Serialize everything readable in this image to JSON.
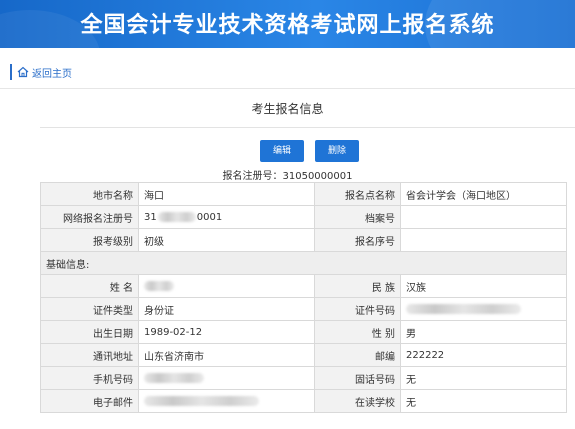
{
  "header": {
    "title": "全国会计专业技术资格考试网上报名系统"
  },
  "nav": {
    "back_label": "返回主页"
  },
  "page": {
    "title": "考生报名信息"
  },
  "actions": {
    "edit_label": "编辑",
    "delete_label": "删除"
  },
  "registration": {
    "line": "报名注册号：31050000001"
  },
  "table": {
    "rows": {
      "city_label": "地市名称",
      "city_value": "海口",
      "site_label": "报名点名称",
      "site_value": "省会计学会（海口地区）",
      "online_no_label": "网络报名注册号",
      "online_no_prefix": "31",
      "online_no_suffix": "0001",
      "archive_label": "档案号",
      "archive_value": "",
      "level_label": "报考级别",
      "level_value": "初级",
      "seq_label": "报名序号",
      "seq_value": ""
    },
    "section_basic": "基础信息:",
    "basic": {
      "name_label": "姓 名",
      "ethnicity_label": "民 族",
      "ethnicity_value": "汉族",
      "idtype_label": "证件类型",
      "idtype_value": "身份证",
      "idno_label": "证件号码",
      "dob_label": "出生日期",
      "dob_value": "1989-02-12",
      "gender_label": "性 别",
      "gender_value": "男",
      "address_label": "通讯地址",
      "address_value": "山东省济南市",
      "postcode_label": "邮编",
      "postcode_value": "222222",
      "mobile_label": "手机号码",
      "landline_label": "固话号码",
      "landline_value": "无",
      "email_label": "电子邮件",
      "school_label": "在读学校",
      "school_value": "无"
    }
  },
  "colors": {
    "header_bg": "#1f74d6",
    "button_bg": "#1f74d6",
    "link": "#2a6ec9",
    "label_bg": "#f2f2f2"
  },
  "icons": {
    "home": "home-icon"
  }
}
